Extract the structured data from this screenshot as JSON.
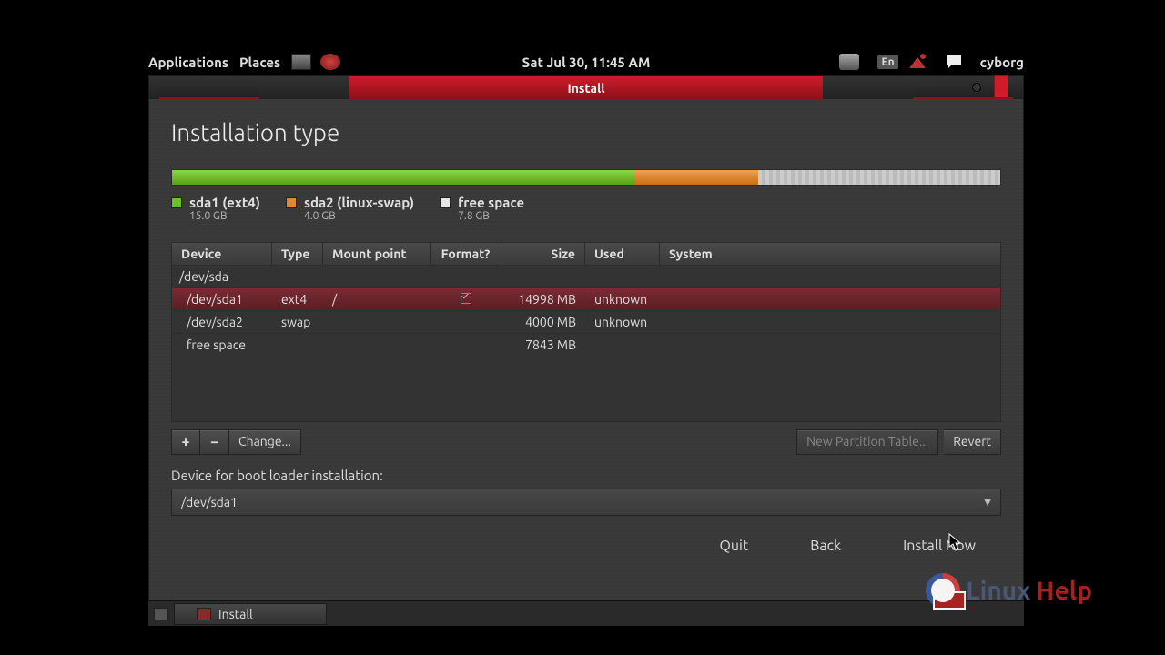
{
  "topbar": {
    "applications": "Applications",
    "places": "Places",
    "clock": "Sat Jul 30, 11:45 AM",
    "lang": "En",
    "user": "cyborg"
  },
  "window": {
    "title": "Install"
  },
  "page": {
    "heading": "Installation type"
  },
  "partitions": {
    "bar": [
      {
        "color": "green",
        "pct": 55.9
      },
      {
        "color": "orange",
        "pct": 14.9
      },
      {
        "color": "grey",
        "pct": 29.2
      }
    ],
    "legend": [
      {
        "swatch": "#6cbf2a",
        "label": "sda1 (ext4)",
        "sub": "15.0 GB"
      },
      {
        "swatch": "#e0892c",
        "label": "sda2 (linux-swap)",
        "sub": "4.0 GB"
      },
      {
        "swatch": "#e6e6e6",
        "label": "free space",
        "sub": "7.8 GB"
      }
    ]
  },
  "table": {
    "headers": {
      "device": "Device",
      "type": "Type",
      "mount": "Mount point",
      "format": "Format?",
      "size": "Size",
      "used": "Used",
      "system": "System"
    },
    "rows": [
      {
        "device": "/dev/sda",
        "type": "",
        "mount": "",
        "format": false,
        "size": "",
        "used": "",
        "system": "",
        "level": 0,
        "selected": false
      },
      {
        "device": "/dev/sda1",
        "type": "ext4",
        "mount": "/",
        "format": true,
        "size": "14998 MB",
        "used": "unknown",
        "system": "",
        "level": 1,
        "selected": true
      },
      {
        "device": "/dev/sda2",
        "type": "swap",
        "mount": "",
        "format": false,
        "size": "4000 MB",
        "used": "unknown",
        "system": "",
        "level": 1,
        "selected": false
      },
      {
        "device": "free space",
        "type": "",
        "mount": "",
        "format": false,
        "size": "7843 MB",
        "used": "",
        "system": "",
        "level": 1,
        "selected": false
      }
    ]
  },
  "toolbar": {
    "add": "+",
    "remove": "−",
    "change": "Change...",
    "new_table": "New Partition Table...",
    "revert": "Revert"
  },
  "bootloader": {
    "label": "Device for boot loader installation:",
    "value": "/dev/sda1"
  },
  "footer": {
    "quit": "Quit",
    "back": "Back",
    "install": "Install Now"
  },
  "taskbar": {
    "app": "Install"
  },
  "watermark": {
    "text_left": "Linux",
    "text_right": "Help"
  }
}
